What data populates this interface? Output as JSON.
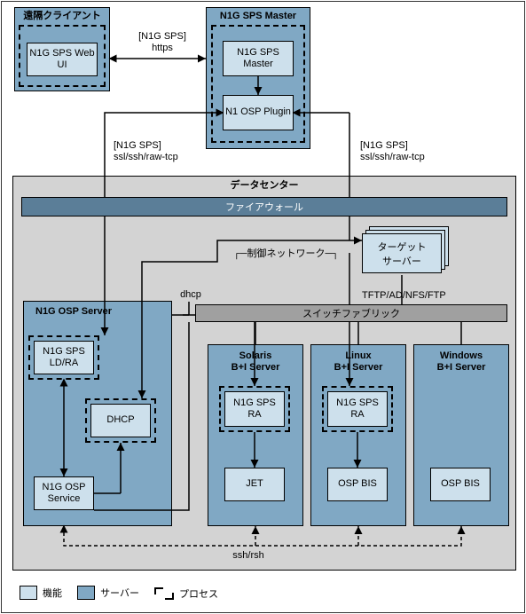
{
  "remote_client": {
    "title": "遠隔クライアント",
    "web_ui": "N1G SPS\nWeb UI"
  },
  "sps_master": {
    "title": "N1G SPS Master",
    "master": "N1G SPS\nMaster",
    "plugin": "N1 OSP\nPlugin"
  },
  "labels": {
    "https": "[N1G SPS]\nhttps",
    "ssl_left": "[N1G SPS]\nssl/ssh/raw-tcp",
    "ssl_right": "[N1G SPS]\nssl/ssh/raw-tcp",
    "datacenter": "データセンター",
    "firewall": "ファイアウォール",
    "control_net": "制御ネットワーク",
    "dhcp": "dhcp",
    "tftp": "TFTP/AD/NFS/FTP",
    "switch": "スイッチファブリック",
    "ssh_rsh": "ssh/rsh",
    "target": "ターゲット\nサーバー"
  },
  "osp_server": {
    "title": "N1G OSP Server",
    "ldra": "N1G SPS\nLD/RA",
    "dhcp": "DHCP",
    "service": "N1G OSP\nService"
  },
  "servers": {
    "solaris": {
      "title": "Solaris\nB+I Server",
      "ra": "N1G SPS\nRA",
      "box": "JET"
    },
    "linux": {
      "title": "Linux\nB+I Server",
      "ra": "N1G SPS\nRA",
      "box": "OSP BIS"
    },
    "windows": {
      "title": "Windows\nB+I Server",
      "box": "OSP BIS"
    }
  },
  "legend": {
    "func": "機能",
    "server": "サーバー",
    "process": "プロセス"
  }
}
